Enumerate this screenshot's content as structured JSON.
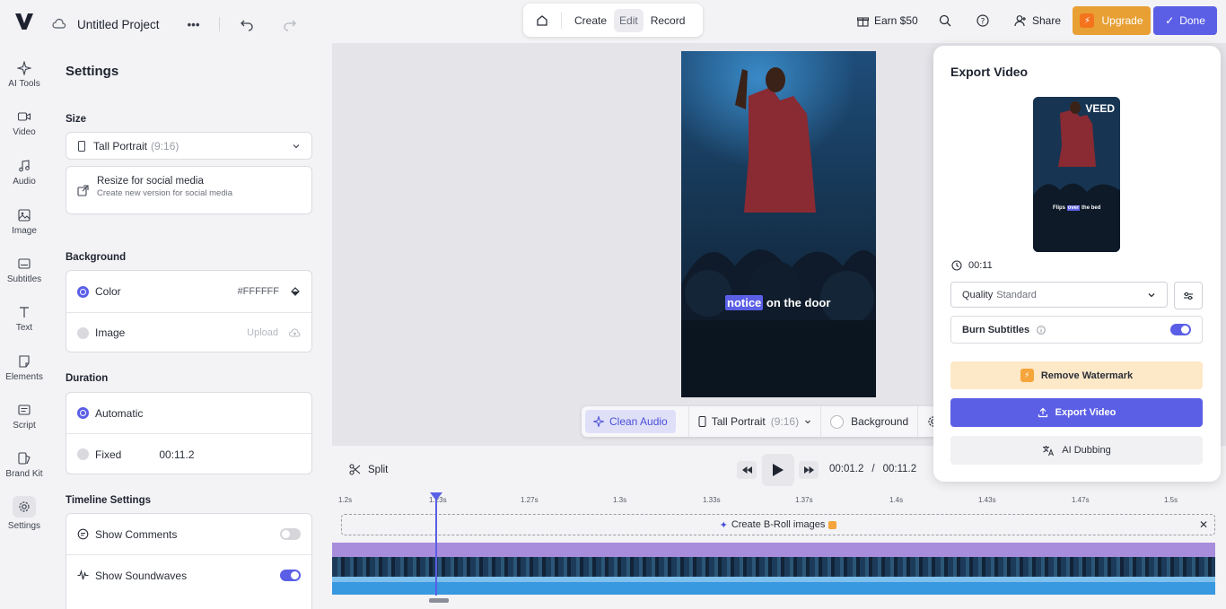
{
  "header": {
    "project_title": "Untitled Project",
    "tabs": [
      "Create",
      "Edit",
      "Record"
    ],
    "active_tab": "Edit",
    "earn_label": "Earn $50",
    "share_label": "Share",
    "upgrade_label": "Upgrade",
    "done_label": "Done"
  },
  "rail": {
    "items": [
      {
        "label": "AI Tools",
        "icon": "sparkle-icon"
      },
      {
        "label": "Video",
        "icon": "video-icon"
      },
      {
        "label": "Audio",
        "icon": "music-icon"
      },
      {
        "label": "Image",
        "icon": "image-icon"
      },
      {
        "label": "Subtitles",
        "icon": "subtitles-icon"
      },
      {
        "label": "Text",
        "icon": "text-icon"
      },
      {
        "label": "Elements",
        "icon": "elements-icon"
      },
      {
        "label": "Script",
        "icon": "script-icon"
      },
      {
        "label": "Brand Kit",
        "icon": "brand-kit-icon"
      },
      {
        "label": "Settings",
        "icon": "gear-icon"
      }
    ],
    "active": "Settings"
  },
  "settings": {
    "title": "Settings",
    "size_label": "Size",
    "size_value": "Tall Portrait",
    "size_ratio": "(9:16)",
    "resize_title": "Resize for social media",
    "resize_sub": "Create new version for social media",
    "background_label": "Background",
    "bg_color_label": "Color",
    "bg_color_value": "#FFFFFF",
    "bg_image_label": "Image",
    "bg_upload_label": "Upload",
    "duration_label": "Duration",
    "duration_auto": "Automatic",
    "duration_fixed": "Fixed",
    "duration_fixed_value": "00:11.2",
    "timeline_label": "Timeline Settings",
    "show_comments": "Show Comments",
    "show_soundwaves": "Show Soundwaves"
  },
  "canvas": {
    "caption_highlight": "notice",
    "caption_rest": " on the door"
  },
  "floating_toolbar": {
    "clean_audio": "Clean Audio",
    "size_value": "Tall Portrait",
    "size_ratio": "(9:16)",
    "background": "Background"
  },
  "playback": {
    "split_label": "Split",
    "current_time": "00:01.2",
    "separator": "/",
    "total_time": "00:11.2"
  },
  "timeline": {
    "ticks": [
      "1.2s",
      "1.23s",
      "1.27s",
      "1.3s",
      "1.33s",
      "1.37s",
      "1.4s",
      "1.43s",
      "1.47s",
      "1.5s"
    ],
    "broll_label": "Create B-Roll images"
  },
  "export": {
    "title": "Export Video",
    "brand": "VEED",
    "thumb_caption_a": "Flips ",
    "thumb_caption_hl": "over",
    "thumb_caption_b": " the bed",
    "duration": "00:11",
    "quality_label": "Quality",
    "quality_value": "Standard",
    "burn_label": "Burn Subtitles",
    "remove_watermark": "Remove Watermark",
    "export_button": "Export Video",
    "ai_dubbing": "AI Dubbing"
  },
  "colors": {
    "accent": "#5b5fe6",
    "upgrade": "#e8a035"
  }
}
